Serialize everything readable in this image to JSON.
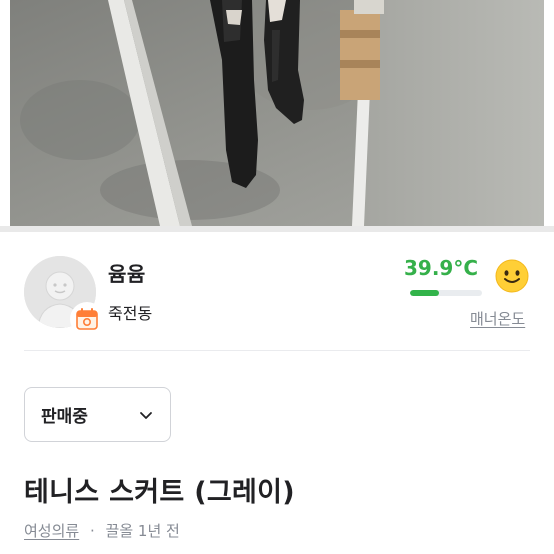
{
  "seller": {
    "name": "윰윰",
    "location": "죽전동"
  },
  "manner": {
    "temperature": "39.9°C",
    "temperature_fraction": 0.4,
    "link_label": "매너온도",
    "color": "#35b04a"
  },
  "status": {
    "selected": "판매중"
  },
  "product": {
    "title": "테니스 스커트 (그레이)",
    "category": "여성의류",
    "separator": "·",
    "time_label": "끌올 1년 전"
  },
  "icons": {
    "avatar": "default-profile-avatar",
    "badge": "calendar-badge-icon",
    "manner_face": "smiley-face-icon",
    "dropdown": "chevron-down-icon"
  }
}
